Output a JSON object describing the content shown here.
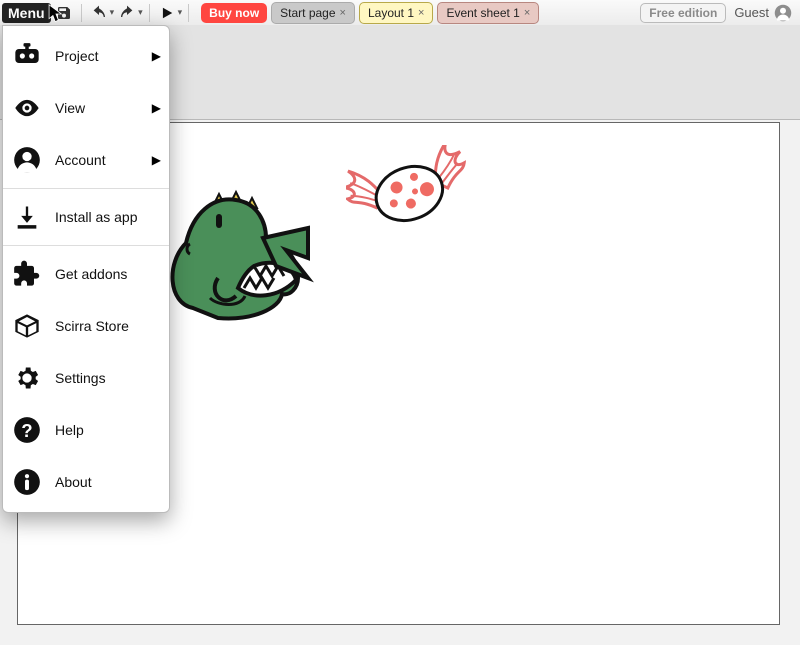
{
  "toolbar": {
    "menu_label": "Menu",
    "free_label": "Free edition",
    "guest_label": "Guest"
  },
  "tabs": {
    "buy": "Buy now",
    "start": "Start page",
    "layout": "Layout 1",
    "event": "Event sheet 1"
  },
  "menu": {
    "project": "Project",
    "view": "View",
    "account": "Account",
    "install": "Install as app",
    "addons": "Get addons",
    "store": "Scirra Store",
    "settings": "Settings",
    "help": "Help",
    "about": "About"
  },
  "canvas": {
    "sprites": [
      "dragon",
      "candy"
    ]
  }
}
